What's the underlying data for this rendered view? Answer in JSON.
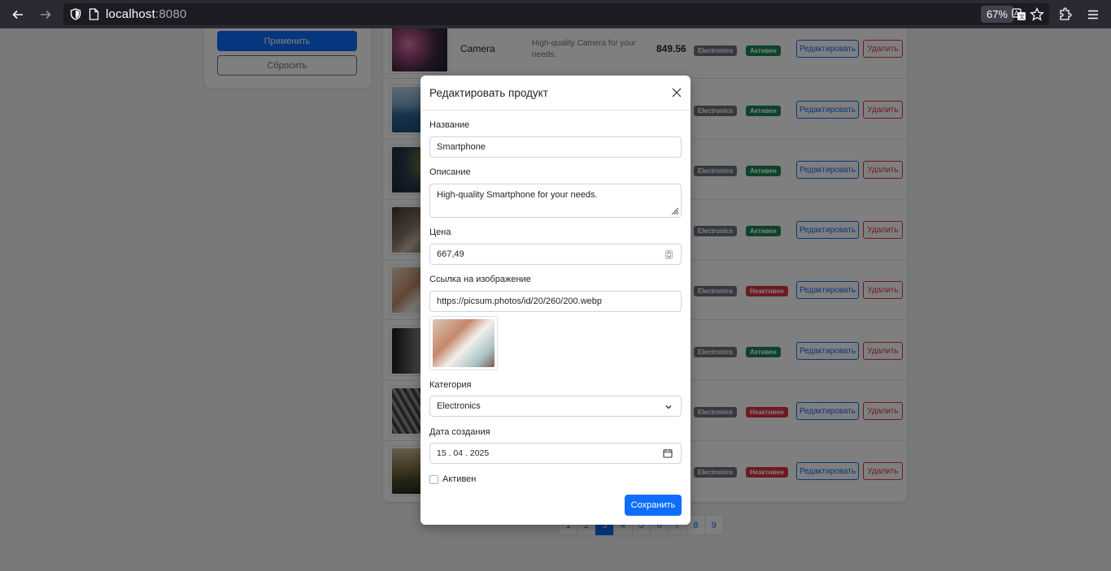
{
  "browser": {
    "url_host": "localhost",
    "url_port": ":8080",
    "zoom": "67%"
  },
  "filters": {
    "apply_label": "Применить",
    "reset_label": "Сбросить"
  },
  "products": [
    {
      "name": "Camera",
      "description": "High-quality Camera for your needs.",
      "price": "849.56",
      "category": "Electronics",
      "status": "Активен",
      "active": true,
      "edit": "Редактировать",
      "delete": "Удалить"
    },
    {
      "category": "Electronics",
      "status": "Активен",
      "active": true,
      "edit": "Редактировать",
      "delete": "Удалить"
    },
    {
      "category": "Electronics",
      "status": "Активен",
      "active": true,
      "edit": "Редактировать",
      "delete": "Удалить"
    },
    {
      "category": "Electronics",
      "status": "Активен",
      "active": true,
      "edit": "Редактировать",
      "delete": "Удалить"
    },
    {
      "category": "Electronics",
      "status": "Неактивен",
      "active": false,
      "edit": "Редактировать",
      "delete": "Удалить"
    },
    {
      "category": "Electronics",
      "status": "Активен",
      "active": true,
      "edit": "Редактировать",
      "delete": "Удалить"
    },
    {
      "category": "Electronics",
      "status": "Неактивен",
      "active": false,
      "edit": "Редактировать",
      "delete": "Удалить"
    },
    {
      "category": "Electronics",
      "status": "Неактивен",
      "active": false,
      "edit": "Редактировать",
      "delete": "Удалить"
    }
  ],
  "pagination": {
    "pages": [
      "1",
      "2",
      "3",
      "4",
      "5",
      "6",
      "7",
      "8",
      "9"
    ],
    "current": "3"
  },
  "modal": {
    "title": "Редактировать продукт",
    "name_label": "Название",
    "name_value": "Smartphone",
    "description_label": "Описание",
    "description_value": "High-quality Smartphone for your needs.",
    "price_label": "Цена",
    "price_value": "667,49",
    "image_label": "Ссылка на изображение",
    "image_value": "https://picsum.photos/id/20/260/200.webp",
    "category_label": "Категория",
    "category_value": "Electronics",
    "date_label": "Дата создания",
    "date_value": "15 . 04 . 2025",
    "active_label": "Активен",
    "active_checked": false,
    "save_label": "Сохранить"
  },
  "colors": {
    "primary": "#0d6efd",
    "danger": "#dc3545",
    "success": "#198754",
    "secondary": "#6c757d"
  }
}
